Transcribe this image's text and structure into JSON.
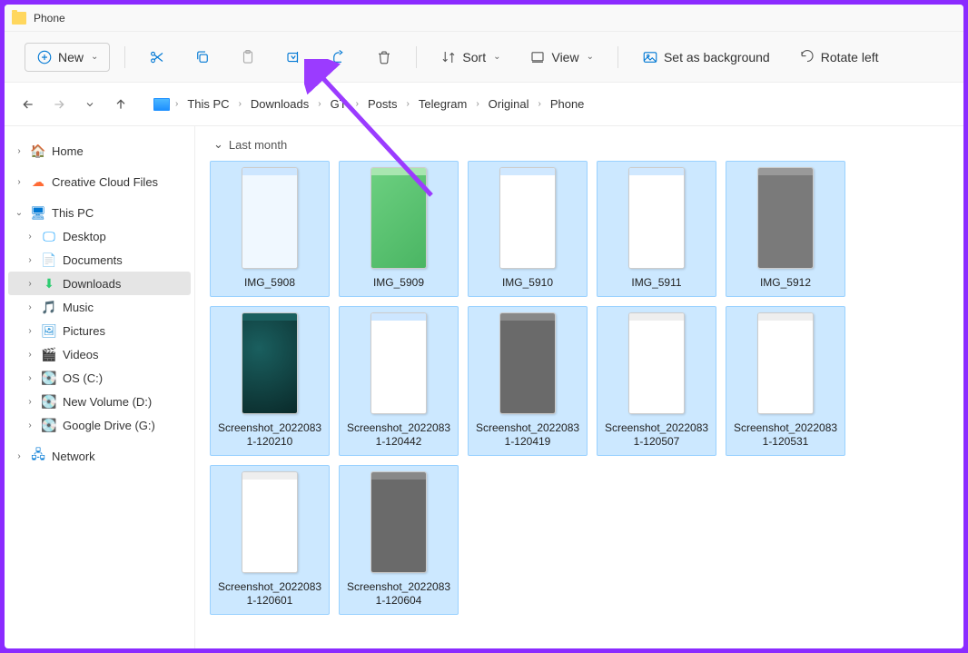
{
  "title": "Phone",
  "toolbar": {
    "new_label": "New",
    "sort_label": "Sort",
    "view_label": "View",
    "background_label": "Set as background",
    "rotate_label": "Rotate left"
  },
  "nav": {
    "breadcrumb": [
      "This PC",
      "Downloads",
      "GT",
      "Posts",
      "Telegram",
      "Original",
      "Phone"
    ]
  },
  "sidebar": {
    "home": "Home",
    "creative": "Creative Cloud Files",
    "thispc": "This PC",
    "desktop": "Desktop",
    "documents": "Documents",
    "downloads": "Downloads",
    "music": "Music",
    "pictures": "Pictures",
    "videos": "Videos",
    "osc": "OS (C:)",
    "newvol": "New Volume (D:)",
    "gdrive": "Google Drive (G:)",
    "network": "Network"
  },
  "content": {
    "group": "Last month",
    "files": [
      {
        "name": "IMG_5908",
        "thumb": {
          "bg": "#f0f8ff",
          "bar": "#cde6ff"
        }
      },
      {
        "name": "IMG_5909",
        "thumb": {
          "bg": "linear-gradient(135deg,#6bcf7f,#4ab563)",
          "bar": "#a8e6b0"
        }
      },
      {
        "name": "IMG_5910",
        "thumb": {
          "bg": "#ffffff",
          "bar": "#d0e8ff"
        }
      },
      {
        "name": "IMG_5911",
        "thumb": {
          "bg": "#ffffff",
          "bar": "#d0e8ff"
        }
      },
      {
        "name": "IMG_5912",
        "thumb": {
          "bg": "#7a7a7a",
          "bar": "#999"
        }
      },
      {
        "name": "Screenshot_20220831-120210",
        "thumb": {
          "bg": "radial-gradient(circle at 30% 30%,#1a5f5f,#0a2a2a)",
          "bar": "#1a5f5f"
        }
      },
      {
        "name": "Screenshot_20220831-120442",
        "thumb": {
          "bg": "#ffffff",
          "bar": "#cde6ff"
        }
      },
      {
        "name": "Screenshot_20220831-120419",
        "thumb": {
          "bg": "#6a6a6a",
          "bar": "#888"
        }
      },
      {
        "name": "Screenshot_20220831-120507",
        "thumb": {
          "bg": "#ffffff",
          "bar": "#eee"
        }
      },
      {
        "name": "Screenshot_20220831-120531",
        "thumb": {
          "bg": "#ffffff",
          "bar": "#eee"
        }
      },
      {
        "name": "Screenshot_20220831-120601",
        "thumb": {
          "bg": "#ffffff",
          "bar": "#eee"
        }
      },
      {
        "name": "Screenshot_20220831-120604",
        "thumb": {
          "bg": "#6a6a6a",
          "bar": "#888"
        }
      }
    ]
  }
}
